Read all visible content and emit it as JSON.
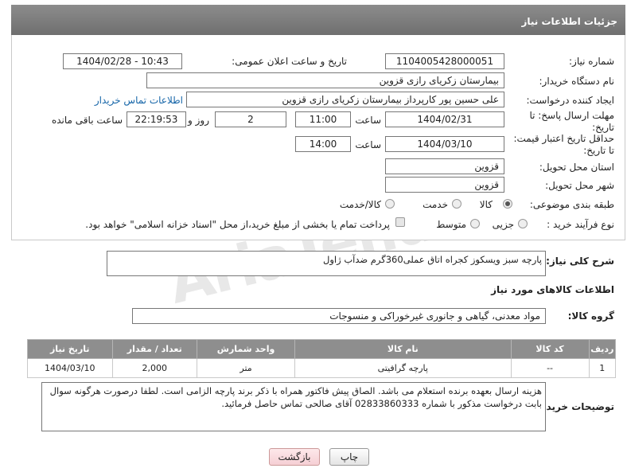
{
  "header": {
    "title": "جزئیات اطلاعات نیاز"
  },
  "watermark": "AriaTender.neT",
  "fields": {
    "need_number_label": "شماره نیاز:",
    "need_number": "1104005428000051",
    "announce_label": "تاریخ و ساعت اعلان عمومی:",
    "announce_value": "1404/02/28 - 10:43",
    "buyer_org_label": "نام دستگاه خریدار:",
    "buyer_org": "بیمارستان زکریای رازی قزوین",
    "creator_label": "ایجاد کننده درخواست:",
    "creator": "علی حسین پور کارپرداز بیمارستان زکریای رازی قزوین",
    "buyer_contact_link": "اطلاعات تماس خریدار",
    "reply_deadline_label": "مهلت ارسال پاسخ: تا تاریخ:",
    "reply_date": "1404/02/31",
    "time_label": "ساعت",
    "reply_time": "11:00",
    "days_value": "2",
    "days_label": "روز و",
    "remaining_time": "22:19:53",
    "remaining_label": "ساعت باقی مانده",
    "price_validity_label": "حداقل تاریخ اعتبار قیمت: تا تاریخ:",
    "price_date": "1404/03/10",
    "price_time": "14:00",
    "province_label": "استان محل تحویل:",
    "province": "قزوین",
    "city_label": "شهر محل تحویل:",
    "city": "قزوین",
    "category_label": "طبقه بندی موضوعی:",
    "category_options": [
      "کالا",
      "خدمت",
      "کالا/خدمت"
    ],
    "process_label": "نوع فرآیند خرید :",
    "process_options": [
      "جزیی",
      "متوسط"
    ],
    "payment_note": "پرداخت تمام یا بخشی از مبلغ خرید،از محل \"اسناد خزانه اسلامی\" خواهد بود."
  },
  "description": {
    "label": "شرح کلی نیاز:",
    "text": "پارچه سبز ویسکوز کجراه اتاق عملی360گرم ضدآب ژاول"
  },
  "goods": {
    "section_title": "اطلاعات کالاهای مورد نیاز",
    "group_label": "گروه کالا:",
    "group_value": "مواد معدنی، گیاهی و جانوری غیرخوراکی و منسوجات",
    "columns": [
      "ردیف",
      "کد کالا",
      "نام کالا",
      "واحد شمارش",
      "تعداد / مقدار",
      "تاریخ نیاز"
    ],
    "rows": [
      {
        "row": "1",
        "code": "--",
        "name": "پارچه گرافیتی",
        "unit": "متر",
        "qty": "2,000",
        "date": "1404/03/10"
      }
    ]
  },
  "buyer_notes": {
    "label": "توضیحات خریدار:",
    "text": "هزینه ارسال بعهده برنده استعلام می باشد. الصاق پیش فاکتور همراه با ذکر برند پارچه الزامی است. لطفا درصورت هرگونه سوال بابت درخواست مذکور با شماره 02833860333 آقای صالحی تماس حاصل فرمائید."
  },
  "buttons": {
    "print": "چاپ",
    "back": "بازگشت"
  }
}
